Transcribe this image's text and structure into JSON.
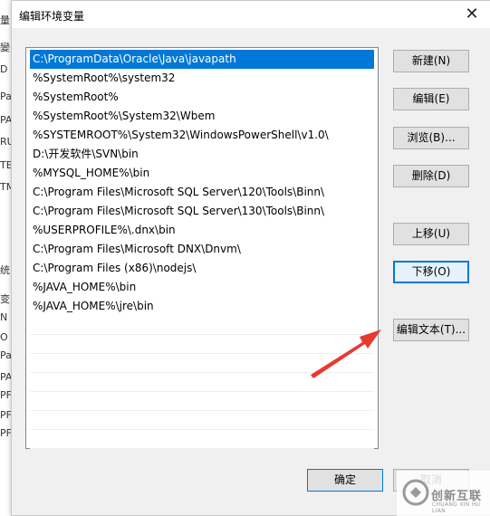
{
  "background_window": {
    "chars": [
      "量",
      "變",
      "D",
      "Pa",
      "PA",
      "RU",
      "TE",
      "TM",
      "统",
      "变",
      "N",
      "O",
      "Pa",
      "PA",
      "PF",
      "PF",
      "PF"
    ]
  },
  "dialog": {
    "title": "编辑环境变量",
    "close_glyph": "✕"
  },
  "path_list": {
    "items": [
      "C:\\ProgramData\\Oracle\\Java\\javapath",
      "%SystemRoot%\\system32",
      "%SystemRoot%",
      "%SystemRoot%\\System32\\Wbem",
      "%SYSTEMROOT%\\System32\\WindowsPowerShell\\v1.0\\",
      "D:\\开发软件\\SVN\\bin",
      "%MYSQL_HOME%\\bin",
      "C:\\Program Files\\Microsoft SQL Server\\120\\Tools\\Binn\\",
      "C:\\Program Files\\Microsoft SQL Server\\130\\Tools\\Binn\\",
      "%USERPROFILE%\\.dnx\\bin",
      "C:\\Program Files\\Microsoft DNX\\Dnvm\\",
      "C:\\Program Files (x86)\\nodejs\\",
      "%JAVA_HOME%\\bin",
      "%JAVA_HOME%\\jre\\bin"
    ],
    "selected_index": 0
  },
  "buttons": {
    "new": "新建(N)",
    "edit": "编辑(E)",
    "browse": "浏览(B)...",
    "delete": "删除(D)",
    "move_up": "上移(U)",
    "move_down": "下移(O)",
    "edit_text": "编辑文本(T)...",
    "ok": "确定",
    "cancel": "取消"
  },
  "watermark": {
    "text": "创新互联",
    "sub": "CHUANG XIN HU LIAN"
  },
  "colors": {
    "selection": "#0078d7",
    "arrow": "#e8392f"
  }
}
